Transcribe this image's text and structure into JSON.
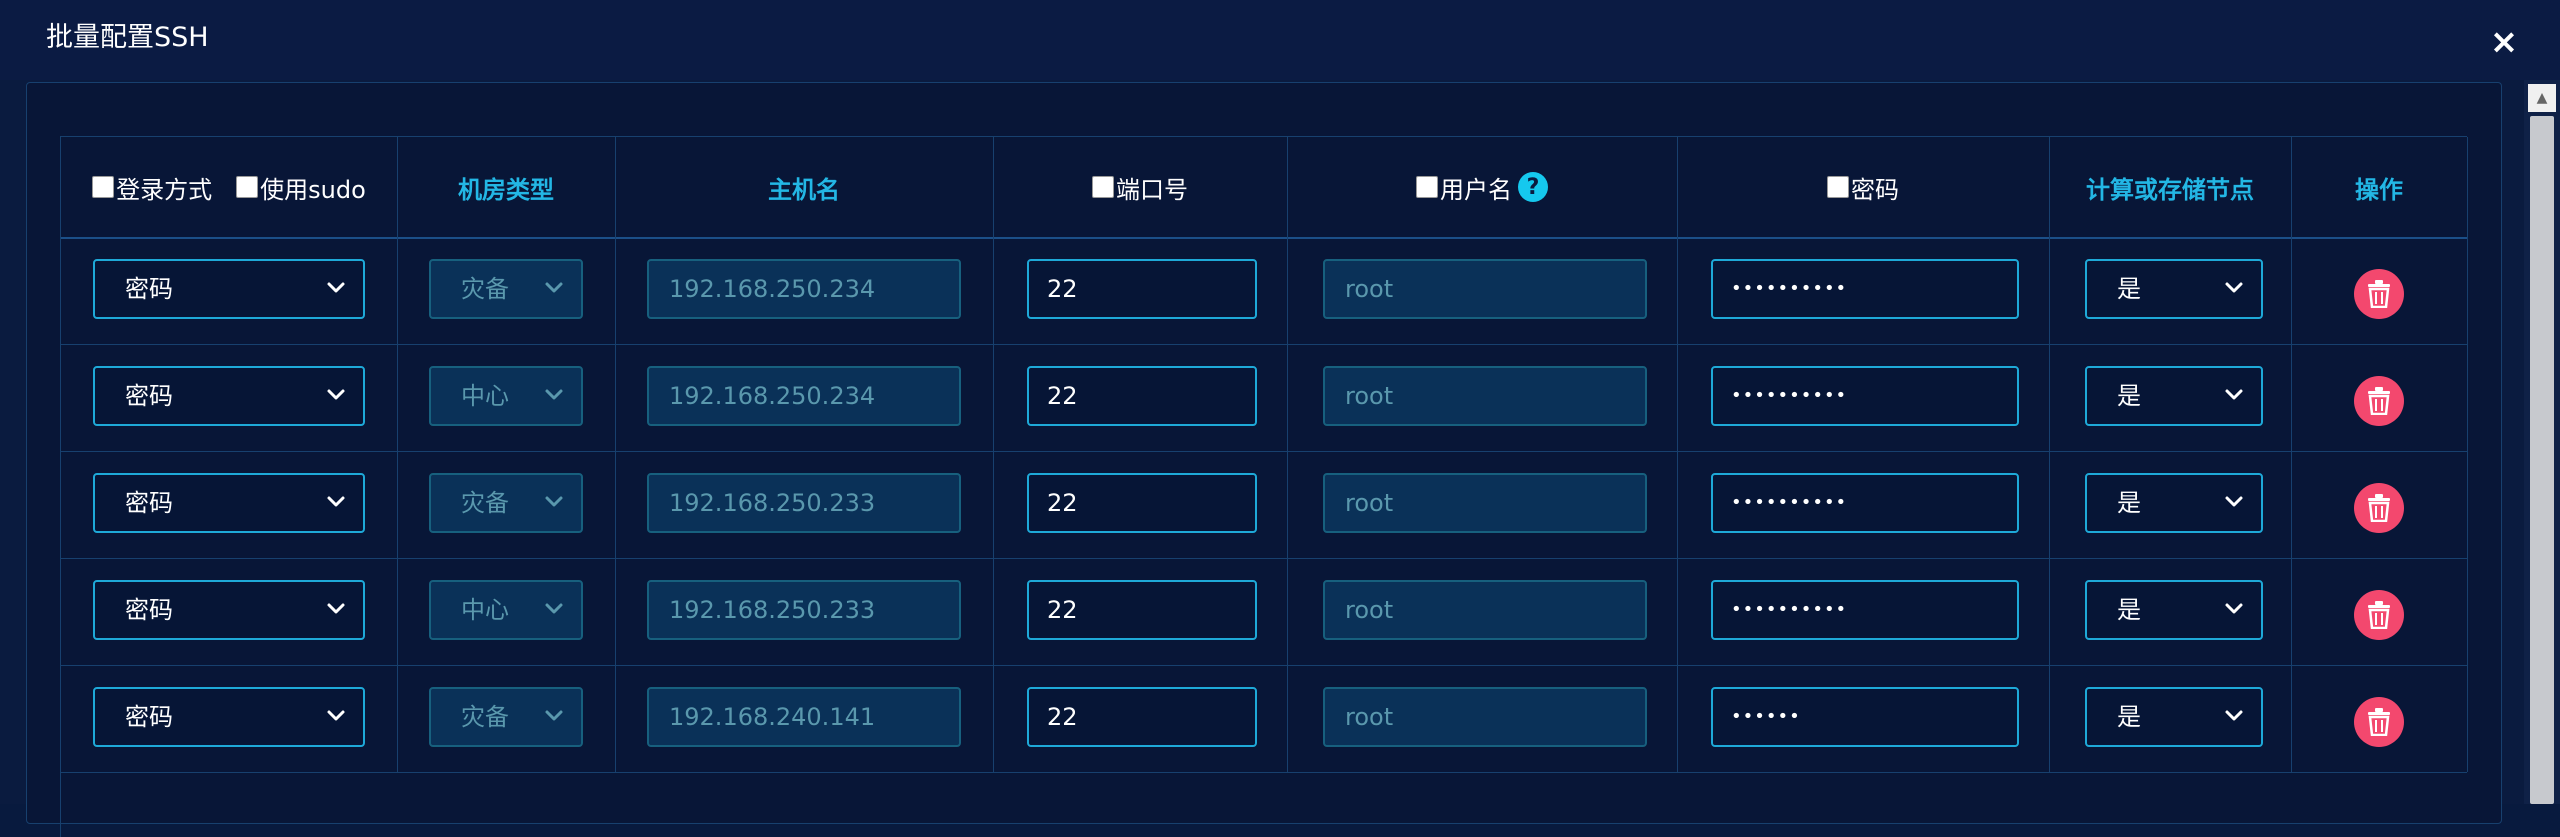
{
  "dialog": {
    "title": "批量配置SSH",
    "close_label": "×"
  },
  "headers": {
    "login_method": "登录方式",
    "use_sudo": "使用sudo",
    "room_type": "机房类型",
    "hostname": "主机名",
    "port": "端口号",
    "username": "用户名",
    "help_icon": "?",
    "password": "密码",
    "node_type": "计算或存储节点",
    "actions": "操作"
  },
  "rows": [
    {
      "login": "密码",
      "room": "灾备",
      "host": "192.168.250.234",
      "port": "22",
      "user": "root",
      "password": "••••••••••",
      "node": "是"
    },
    {
      "login": "密码",
      "room": "中心",
      "host": "192.168.250.234",
      "port": "22",
      "user": "root",
      "password": "••••••••••",
      "node": "是"
    },
    {
      "login": "密码",
      "room": "灾备",
      "host": "192.168.250.233",
      "port": "22",
      "user": "root",
      "password": "••••••••••",
      "node": "是"
    },
    {
      "login": "密码",
      "room": "中心",
      "host": "192.168.250.233",
      "port": "22",
      "user": "root",
      "password": "••••••••••",
      "node": "是"
    },
    {
      "login": "密码",
      "room": "灾备",
      "host": "192.168.240.141",
      "port": "22",
      "user": "root",
      "password": "••••••",
      "node": "是"
    }
  ],
  "colors": {
    "accent": "#23b7e5",
    "delete": "#f3486e",
    "background": "#0a1b3f"
  }
}
